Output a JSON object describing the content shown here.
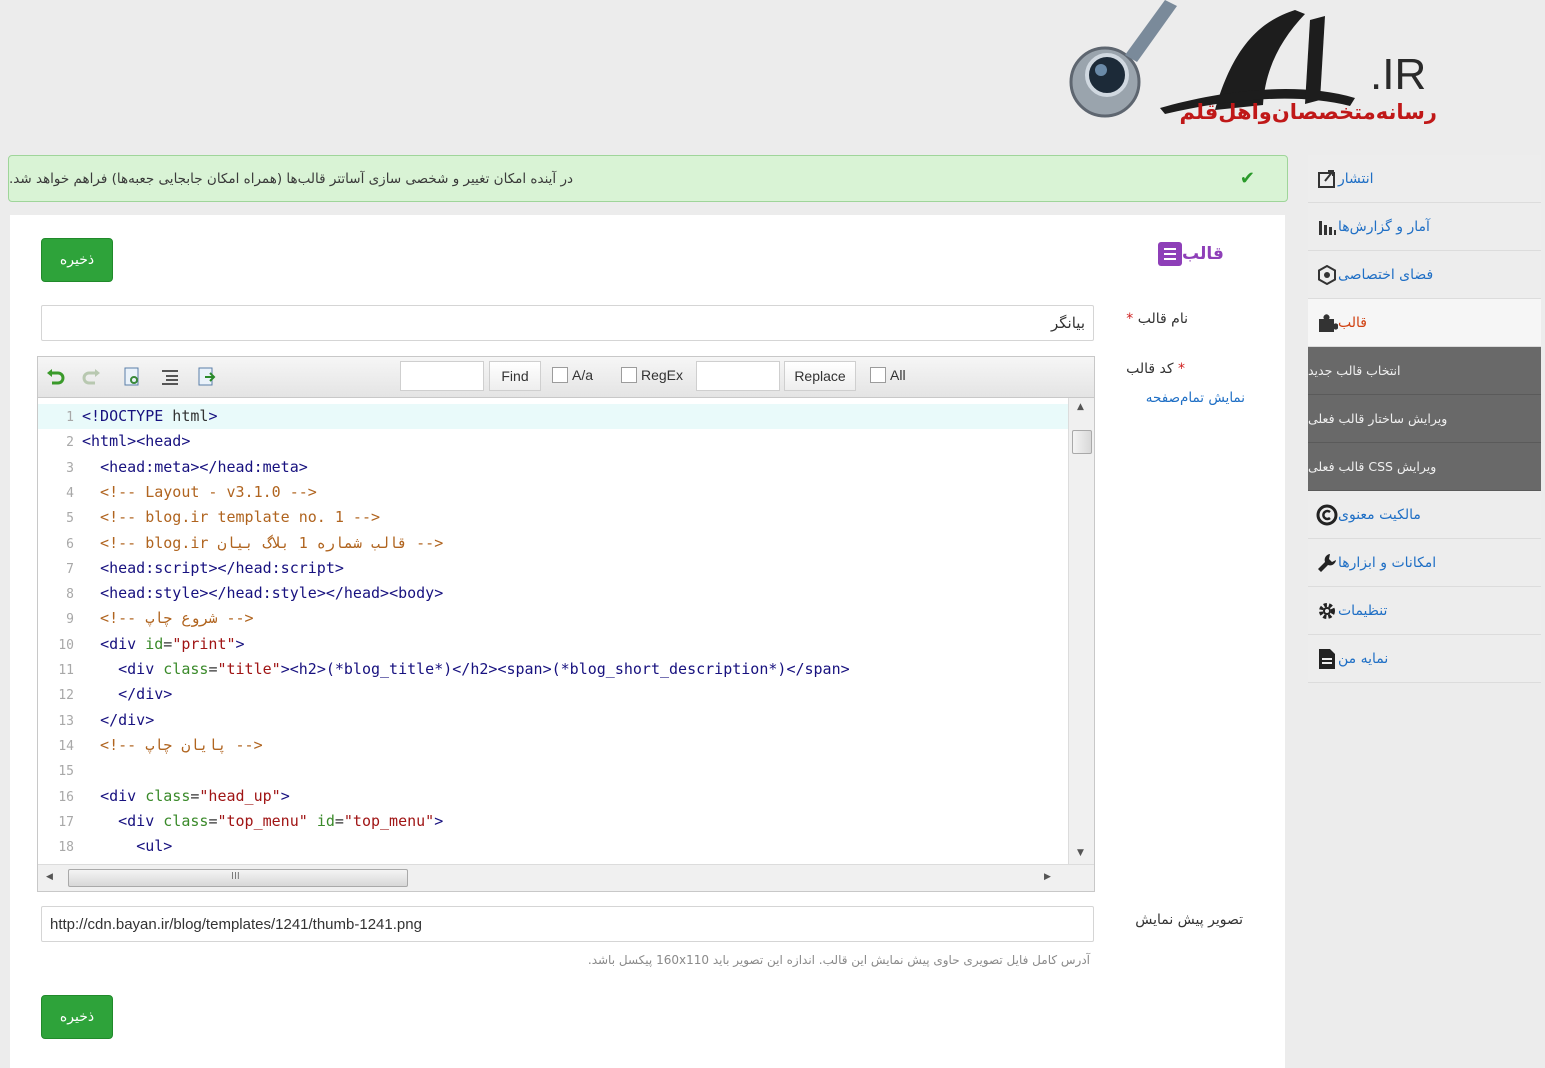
{
  "logo": {
    "tld": ".IR",
    "tagline": "رسانه‌متخصصان‌واهل‌قلم"
  },
  "notice": {
    "text": "در آینده امکان تغییر و شخصی سازی آساتتر قالب‌ها (همراه امکان جابجایی جعبه‌ها) فراهم خواهد شد."
  },
  "sidebar": {
    "items": [
      {
        "label": "انتشار",
        "icon": "publish-icon"
      },
      {
        "label": "آمار و گزارش‌ها",
        "icon": "stats-icon"
      },
      {
        "label": "فضای اختصاصی",
        "icon": "space-icon"
      },
      {
        "label": "قالب",
        "icon": "puzzle-icon"
      },
      {
        "label": "مالکیت معنوی",
        "icon": "copyright-icon"
      },
      {
        "label": "امکانات و ابزارها",
        "icon": "wrench-icon"
      },
      {
        "label": "تنظیمات",
        "icon": "gear-icon"
      },
      {
        "label": "نمایه من",
        "icon": "profile-icon"
      }
    ],
    "sub_items": [
      {
        "label": "انتخاب قالب جدید"
      },
      {
        "label": "ویرایش ساختار قالب فعلی"
      },
      {
        "label": "ویرایش CSS قالب فعلی"
      }
    ]
  },
  "page": {
    "title": "قالب",
    "save_label": "ذخیره",
    "name_label": "نام قالب",
    "name_value": "بیانگر",
    "code_label": "کد قالب",
    "required_mark": "*",
    "fullscreen_link": "نمایش تمام‌صفحه",
    "preview_label": "تصویر پیش نمایش",
    "preview_value": "http://cdn.bayan.ir/blog/templates/1241/thumb-1241.png",
    "preview_hint": "آدرس کامل فایل تصویری حاوی پیش نمایش این قالب. اندازه این تصویر باید 160x110 پیکسل باشد."
  },
  "editor": {
    "find_label": "Find",
    "case_label": "A/a",
    "regex_label": "RegEx",
    "replace_label": "Replace",
    "all_label": "All",
    "hscroll_grip": "III",
    "lines": [
      {
        "n": "1",
        "text": "<!DOCTYPE html>"
      },
      {
        "n": "2",
        "text": "<html><head>"
      },
      {
        "n": "3",
        "text": "  <head:meta></head:meta>"
      },
      {
        "n": "4",
        "text": "  <!-- Layout - v3.1.0 -->"
      },
      {
        "n": "5",
        "text": "  <!-- blog.ir template no. 1 -->"
      },
      {
        "n": "6",
        "text": "  <!-- blog.ir قالب شماره 1 بلاگ بیان -->"
      },
      {
        "n": "7",
        "text": "  <head:script></head:script>"
      },
      {
        "n": "8",
        "text": "  <head:style></head:style></head><body>"
      },
      {
        "n": "9",
        "text": "  <!-- شروع چاپ -->"
      },
      {
        "n": "10",
        "text": "  <div id=\"print\">"
      },
      {
        "n": "11",
        "text": "    <div class=\"title\"><h2>(*blog_title*)</h2><span>(*blog_short_description*)</span>"
      },
      {
        "n": "12",
        "text": "    </div>"
      },
      {
        "n": "13",
        "text": "  </div>"
      },
      {
        "n": "14",
        "text": "  <!-- پایان چاپ -->"
      },
      {
        "n": "15",
        "text": ""
      },
      {
        "n": "16",
        "text": "  <div class=\"head_up\">"
      },
      {
        "n": "17",
        "text": "    <div class=\"top_menu\" id=\"top_menu\">"
      },
      {
        "n": "18",
        "text": "      <ul>"
      }
    ]
  }
}
